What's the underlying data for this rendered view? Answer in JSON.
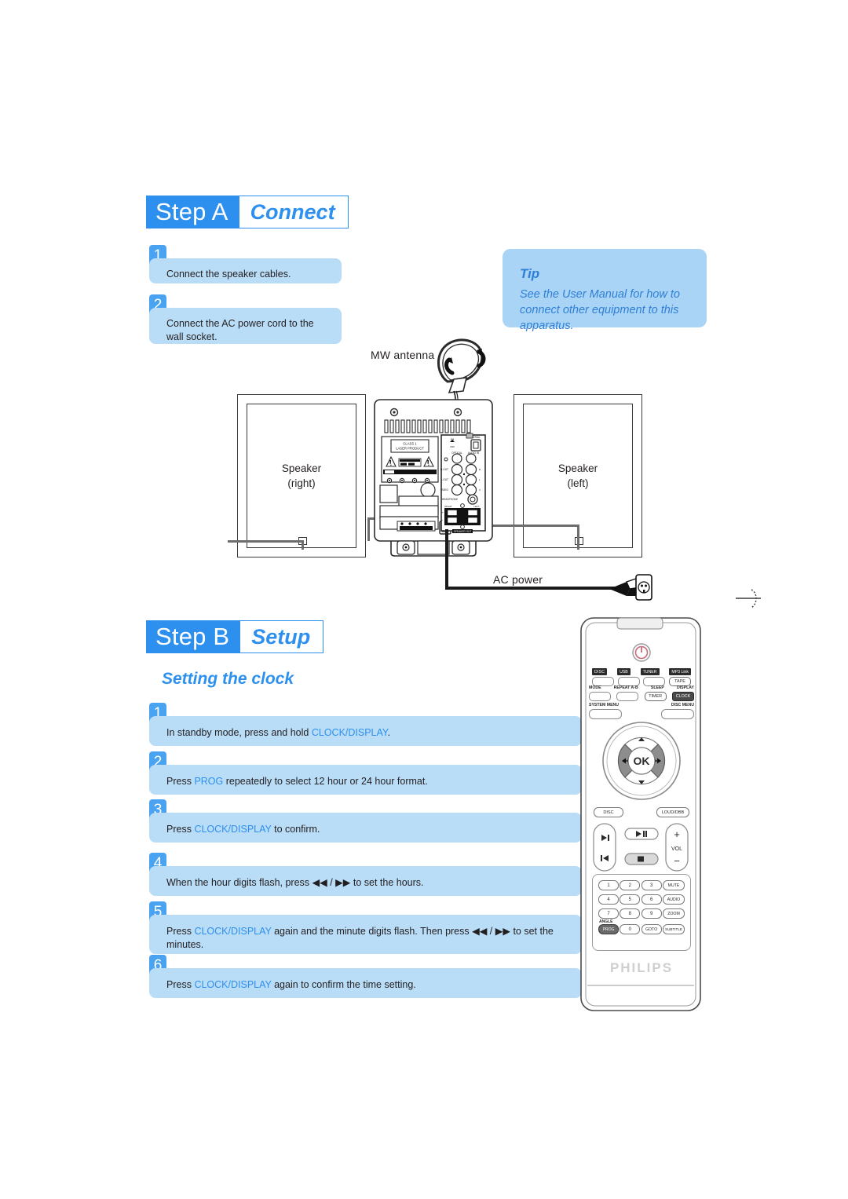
{
  "steps": [
    {
      "id": "step-a",
      "badge": "Step A",
      "word": "Connect",
      "items": [
        {
          "num": "1",
          "text": "Connect the speaker cables."
        },
        {
          "num": "2",
          "text": "Connect the AC power cord to the wall socket."
        }
      ]
    },
    {
      "id": "step-b",
      "badge": "Step B",
      "word": "Setup",
      "subheading": "Setting the clock",
      "items": [
        {
          "num": "1",
          "pre": "In standby mode, press and hold ",
          "key": "CLOCK/DISPLAY",
          "post": "."
        },
        {
          "num": "2",
          "pre": "Press ",
          "key": "PROG",
          "post": " repeatedly to select 12 hour or 24 hour format."
        },
        {
          "num": "3",
          "pre": "Press ",
          "key": "CLOCK/DISPLAY",
          "post": " to confirm."
        },
        {
          "num": "4",
          "pre": "When the hour digits flash, press ",
          "key": "",
          "post": " ◀◀ / ▶▶ to set the hours."
        },
        {
          "num": "5",
          "pre": "Press ",
          "key": "CLOCK/DISPLAY",
          "post": " again and the minute digits flash. Then press ◀◀ / ▶▶ to set the minutes."
        },
        {
          "num": "6",
          "pre": "Press ",
          "key": "CLOCK/DISPLAY",
          "post": " again to confirm the time setting."
        }
      ]
    }
  ],
  "tip": {
    "title": "Tip",
    "body": "See the User Manual for how to connect other equipment to this apparatus."
  },
  "diagram": {
    "mw_antenna_label": "MW antenna",
    "ac_power_label": "AC power",
    "speaker_right": {
      "line1": "Speaker",
      "line2": "(right)"
    },
    "speaker_left": {
      "line1": "Speaker",
      "line2": "(left)"
    },
    "unit_labels": {
      "laser_line1": "CLASS 1",
      "laser_line2": "LASER PRODUCT",
      "caution": "CAUTION",
      "speaker_out": "SPEAKER OUT",
      "right_terminal": "RIGHT",
      "left_terminal": "LEFT",
      "plus": "+",
      "minus": "-",
      "headphone": "HEADPHONE",
      "optical": "OPTICAL",
      "audio_in": "AUDIO IN",
      "fm": "FM",
      "mw": "MW",
      "aerial": "AERIAL",
      "r_out": "R-OUT",
      "l_out": "L-OUT",
      "video": "VIDEO"
    }
  },
  "remote": {
    "brand": "PHILIPS",
    "power_icon": "power-icon",
    "source_row": [
      "DISC",
      "USB",
      "TUNER",
      "MP3 Link"
    ],
    "tape_button": "TAPE",
    "function_row": [
      "MODE",
      "REPEAT A-B",
      "SLEEP",
      "DISPLAY"
    ],
    "timer_button": "TIMER",
    "clock_button": "CLOCK",
    "menu_row": [
      "SYSTEM MENU",
      "DISC MENU"
    ],
    "nav": {
      "ok": "OK",
      "up": "▲",
      "down": "▼",
      "left": "◀◀",
      "right": "▶▶"
    },
    "disc_button": "DISC",
    "loud_button": "LOUD/DBB",
    "transport": {
      "play_pause": "▶II",
      "prev": "I◀",
      "next": "▶I",
      "stop": "■"
    },
    "vol": {
      "label": "VOL",
      "plus": "+",
      "minus": "−"
    },
    "keypad": [
      [
        "1",
        "2",
        "3",
        "MUTE"
      ],
      [
        "4",
        "5",
        "6",
        "AUDIO"
      ],
      [
        "7",
        "8",
        "9",
        "ZOOM"
      ],
      [
        "PROG",
        "0",
        "GOTO",
        "SUBTITLE"
      ]
    ],
    "angle_label": "ANGLE"
  },
  "colors": {
    "accent": "#2e90ee",
    "bubble": "#b9dcf7",
    "tip_bg": "#a9d4f5",
    "tip_text": "#2e7fd6",
    "num_badge": "#4aa3f0",
    "ink": "#231f20"
  }
}
